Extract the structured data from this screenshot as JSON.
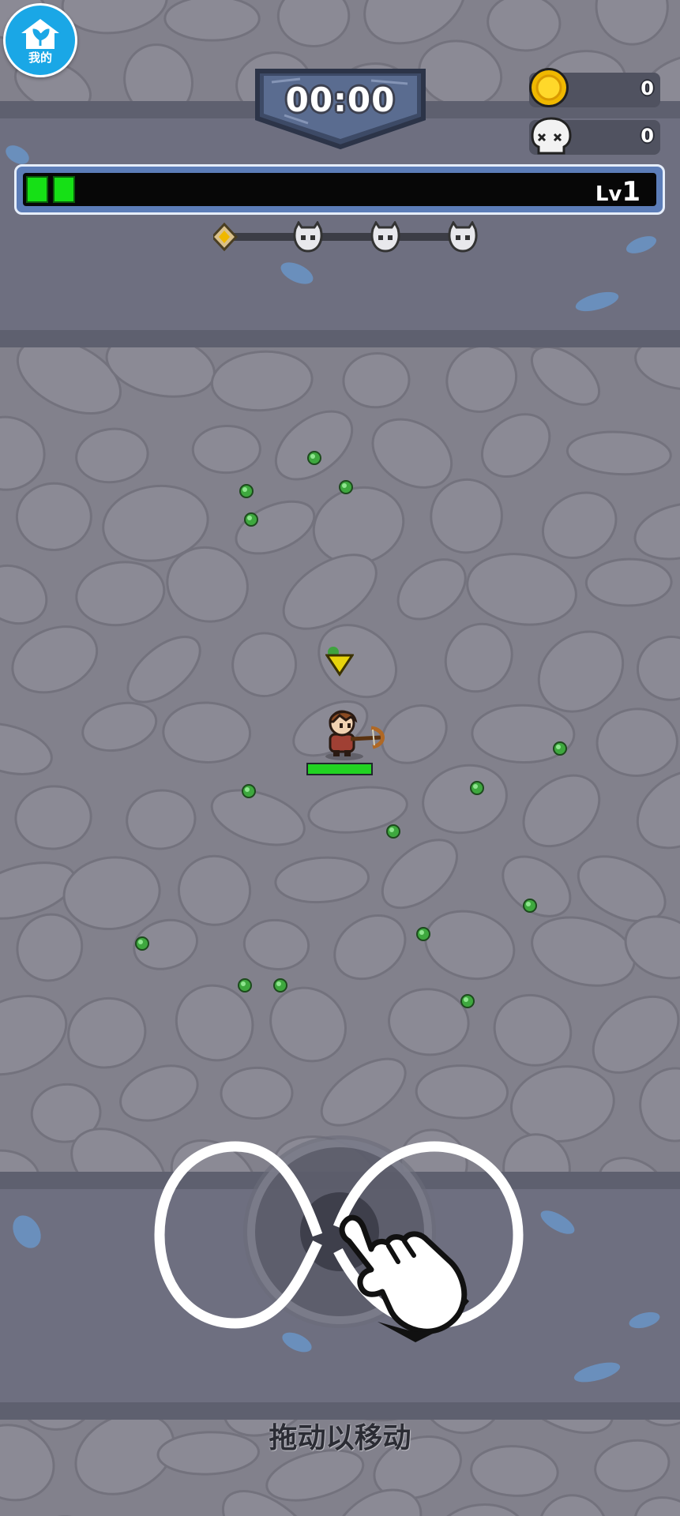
{
  "hud": {
    "home_label": "我的",
    "timer": "00:00",
    "coins": "0",
    "kills": "0",
    "level_prefix": "Lv",
    "level_number": "1",
    "xp_progress": 0.07,
    "xp_segments_filled": 2
  },
  "wave_track": {
    "milestones": [
      "diamond-marker-icon",
      "skull-icon",
      "skull-icon",
      "skull-icon"
    ],
    "progress": 0
  },
  "player": {
    "health_fraction": 1.0,
    "weapon": "crossbow-icon"
  },
  "pickups": {
    "type": "xp-gem-icon",
    "count": 18
  },
  "tutorial": {
    "gesture_icon": "infinity-swipe-icon",
    "hand_icon": "pointing-hand-icon",
    "hint_text": "拖动以移动"
  },
  "colors": {
    "background": "#82818c",
    "band": "#6e6f80",
    "xp_fill": "#16e016",
    "home_button": "#1aa7e6",
    "health_fill": "#22d322"
  }
}
